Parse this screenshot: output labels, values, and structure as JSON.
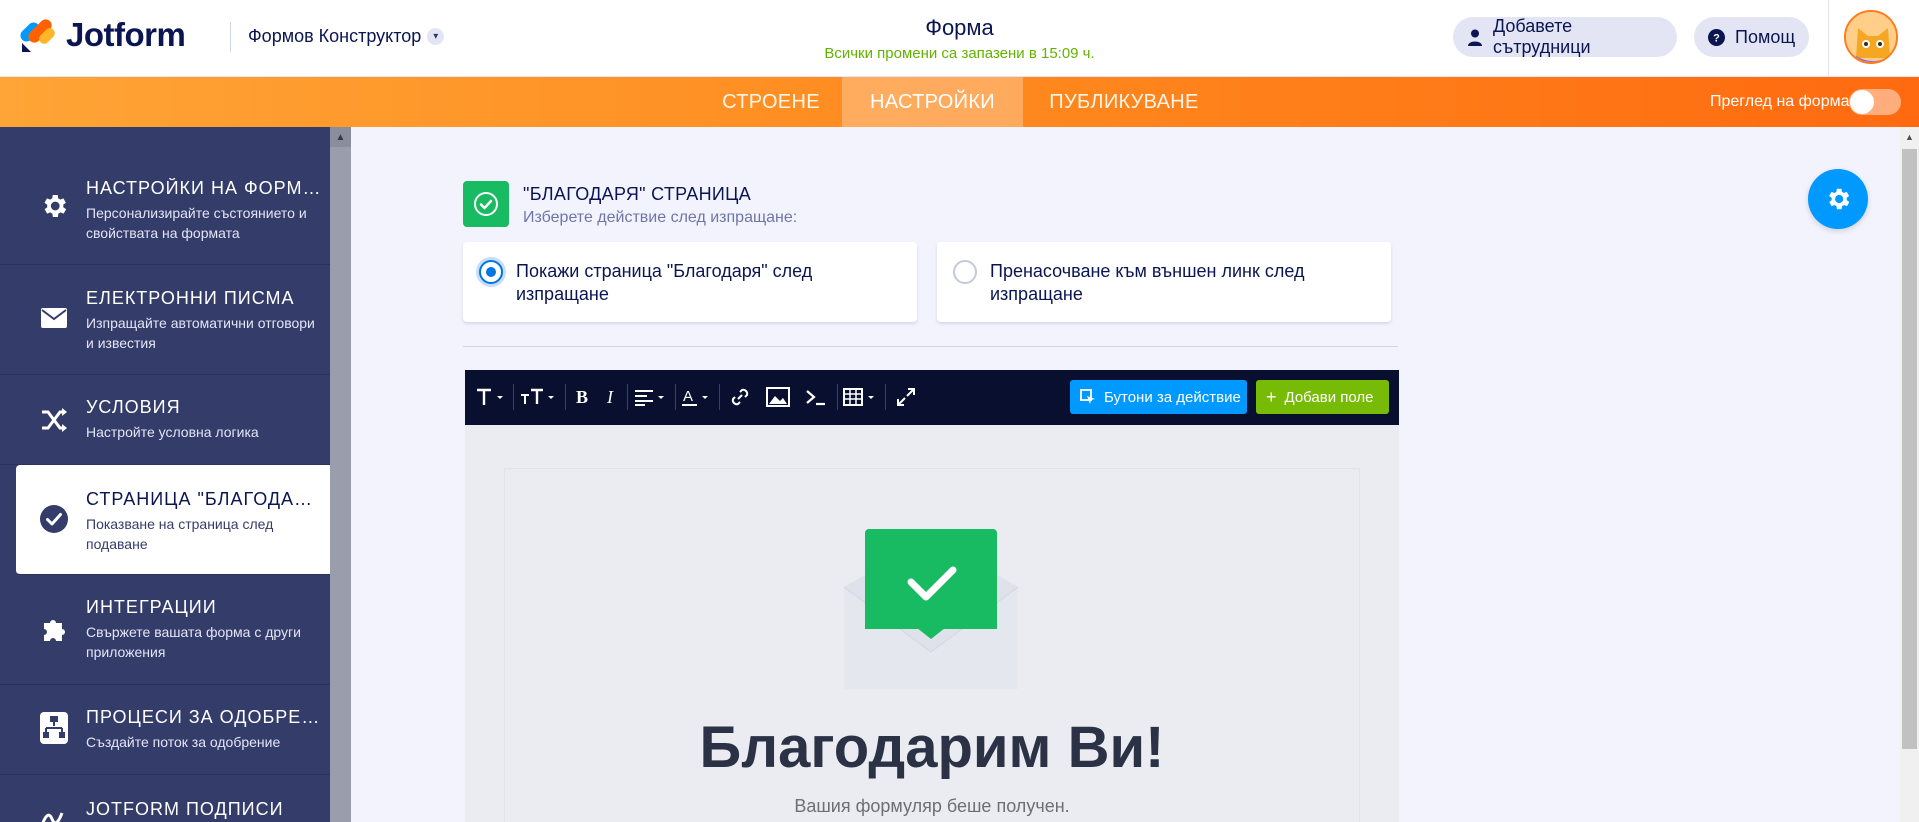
{
  "header": {
    "logo_text": "Jotform",
    "builder_menu": "Формов Конструктор",
    "form_title": "Форма",
    "save_status": "Всички промени са запазени в 15:09 ч.",
    "collab_label": "Добавете сътрудници",
    "help_label": "Помощ"
  },
  "nav": {
    "tabs": [
      {
        "label": "СТРОЕНЕ",
        "active": false
      },
      {
        "label": "НАСТРОЙКИ",
        "active": true
      },
      {
        "label": "ПУБЛИКУВАНЕ",
        "active": false
      }
    ],
    "preview_label": "Преглед на форма"
  },
  "sidebar": {
    "items": [
      {
        "title": "НАСТРОЙКИ НА ФОРМАТА",
        "desc": "Персонализирайте състоянието и свойствата на формата",
        "icon": "gear-icon"
      },
      {
        "title": "ЕЛЕКТРОННИ ПИСМА",
        "desc": "Изпращайте автоматични отговори и известия",
        "icon": "envelope-icon"
      },
      {
        "title": "УСЛОВИЯ",
        "desc": "Настройте условна логика",
        "icon": "shuffle-icon"
      },
      {
        "title": "СТРАНИЦА \"БЛАГОДАРЯ\"",
        "desc": "Показване на страница след подаване",
        "icon": "check-circle-icon",
        "active": true
      },
      {
        "title": "ИНТЕГРАЦИИ",
        "desc": "Свържете вашата форма с други приложения",
        "icon": "puzzle-icon"
      },
      {
        "title": "ПРОЦЕСИ ЗА ОДОБРЕНИЕ",
        "desc": "Създайте поток за одобрение",
        "icon": "flow-icon"
      },
      {
        "title": "JOTFORM ПОДПИСИ",
        "desc": "",
        "icon": "signature-icon"
      }
    ]
  },
  "main": {
    "section_title": "\"БЛАГОДАРЯ\" СТРАНИЦА",
    "section_sub": "Изберете действие след изпращане:",
    "options": [
      {
        "label": "Покажи страница \"Благодаря\" след изпращане",
        "selected": true
      },
      {
        "label": "Пренасочване към външен линк след изпращане",
        "selected": false
      }
    ],
    "action_buttons_label": "Бутони за действие",
    "add_field_label": "Добави поле",
    "thanks_heading": "Благодарим Ви!",
    "received_text": "Вашия формуляр беше получен."
  },
  "colors": {
    "accent_blue": "#0099ff",
    "success_green": "#19bb62",
    "add_green": "#78bb07",
    "sidebar_bg": "#343c6a",
    "nav_orange": "#ff8a1f"
  }
}
